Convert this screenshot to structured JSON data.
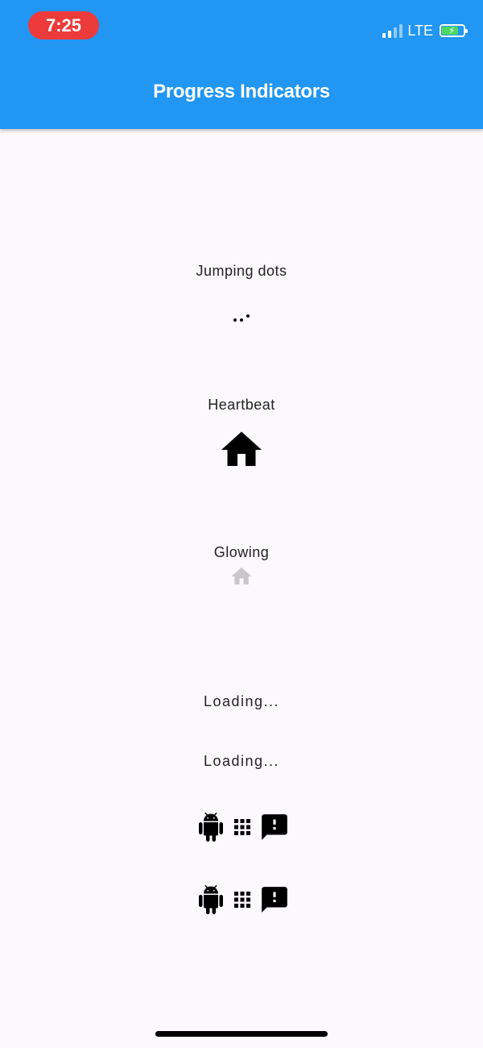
{
  "status_bar": {
    "time": "7:25",
    "network": "LTE"
  },
  "app_bar": {
    "title": "Progress Indicators"
  },
  "sections": {
    "jumping_dots": {
      "label": "Jumping dots"
    },
    "heartbeat": {
      "label": "Heartbeat",
      "icon": "home-icon"
    },
    "glowing": {
      "label": "Glowing",
      "icon": "home-icon"
    },
    "loading_1": {
      "label": "Loading..."
    },
    "loading_2": {
      "label": "Loading..."
    },
    "icon_row_1": {
      "icons": [
        "android-icon",
        "apps-grid-icon",
        "feedback-icon"
      ]
    },
    "icon_row_2": {
      "icons": [
        "android-icon",
        "apps-grid-icon",
        "feedback-icon"
      ]
    }
  },
  "colors": {
    "app_bar": "#2196f3",
    "time_pill": "#ed3b3b",
    "background": "#fbf9fc",
    "glowing_icon": "#c8c8c8"
  }
}
